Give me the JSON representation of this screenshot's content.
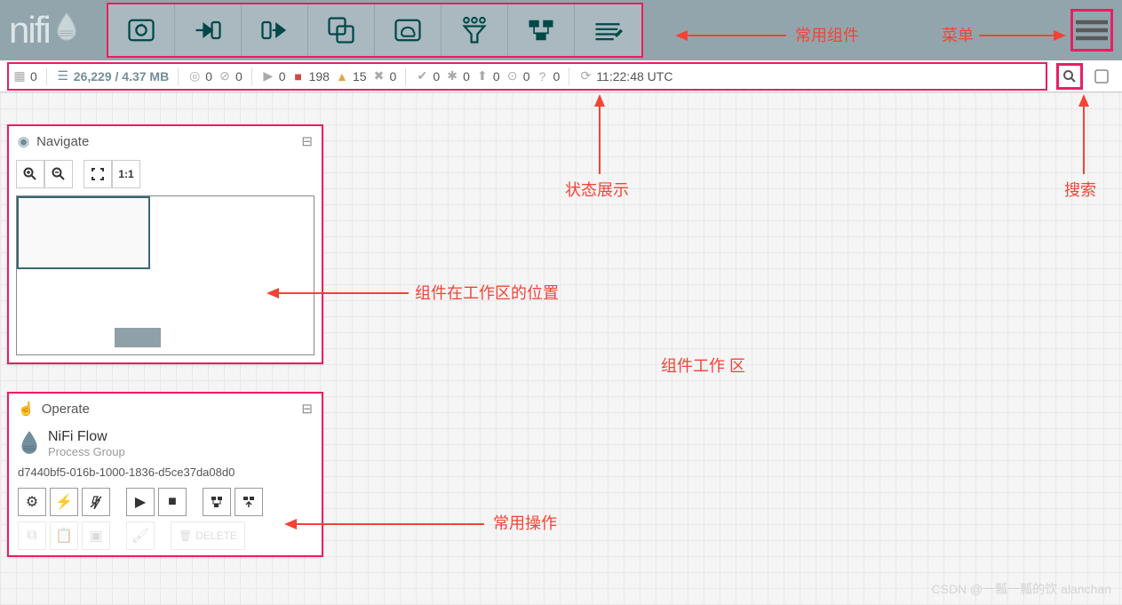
{
  "header": {
    "logo_text": "nifi"
  },
  "status": {
    "groups": "0",
    "queued": "26,229 / 4.37 MB",
    "running": "0",
    "stopped": "0",
    "playing": "0",
    "stopped_count": "198",
    "invalid": "15",
    "disabled": "0",
    "up_to_date": "0",
    "stale": "0",
    "sync_fail": "0",
    "locally_mod": "0",
    "unknown": "0",
    "refresh_time": "11:22:48 UTC"
  },
  "navigate": {
    "title": "Navigate"
  },
  "operate": {
    "title": "Operate",
    "flow_name": "NiFi Flow",
    "flow_type": "Process Group",
    "flow_id": "d7440bf5-016b-1000-1836-d5ce37da08d0",
    "delete_label": "DELETE"
  },
  "annotations": {
    "toolbar": "常用组件",
    "menu": "菜单",
    "status": "状态展示",
    "search": "搜索",
    "nav_pos": "组件在工作区的位置",
    "canvas": "组件工作 区",
    "ops": "常用操作"
  },
  "watermark": "CSDN @一瓢一瓢的饮 alanchan"
}
